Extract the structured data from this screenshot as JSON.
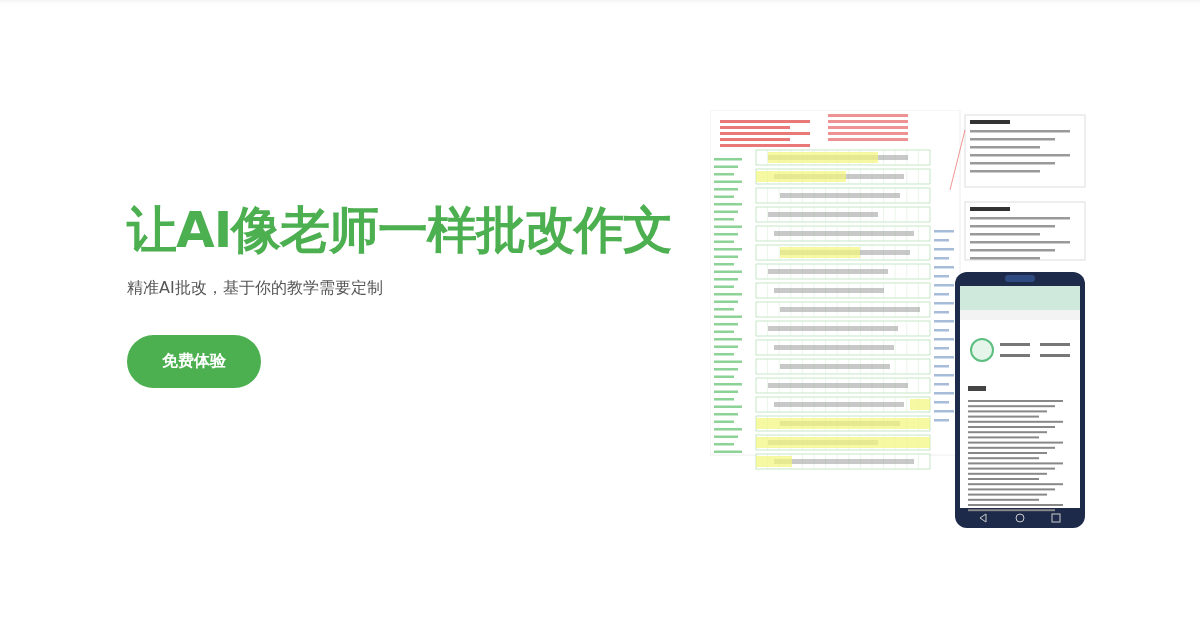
{
  "hero": {
    "title": "让AI像老师一样批改作文",
    "subtitle": "精准AI批改，基于你的教学需要定制",
    "cta": "免费体验"
  }
}
